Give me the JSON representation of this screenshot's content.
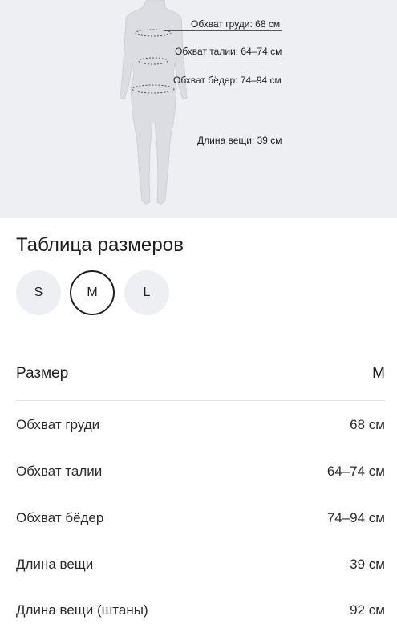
{
  "figure": {
    "chest_label": "Обхват груди: 68 см",
    "waist_label": "Обхват талии: 64–74 см",
    "hips_label": "Обхват бёдер: 74–94 см",
    "length_label": "Длина вещи: 39 см"
  },
  "title": "Таблица размеров",
  "sizes": [
    {
      "label": "S",
      "selected": false
    },
    {
      "label": "M",
      "selected": true
    },
    {
      "label": "L",
      "selected": false
    }
  ],
  "table": {
    "header": {
      "name": "Размер",
      "value": "M"
    },
    "rows": [
      {
        "name": "Обхват груди",
        "value": "68 см"
      },
      {
        "name": "Обхват талии",
        "value": "64–74 см"
      },
      {
        "name": "Обхват бёдер",
        "value": "74–94 см"
      },
      {
        "name": "Длина вещи",
        "value": "39 см"
      },
      {
        "name": "Длина вещи (штаны)",
        "value": "92 см"
      }
    ]
  }
}
